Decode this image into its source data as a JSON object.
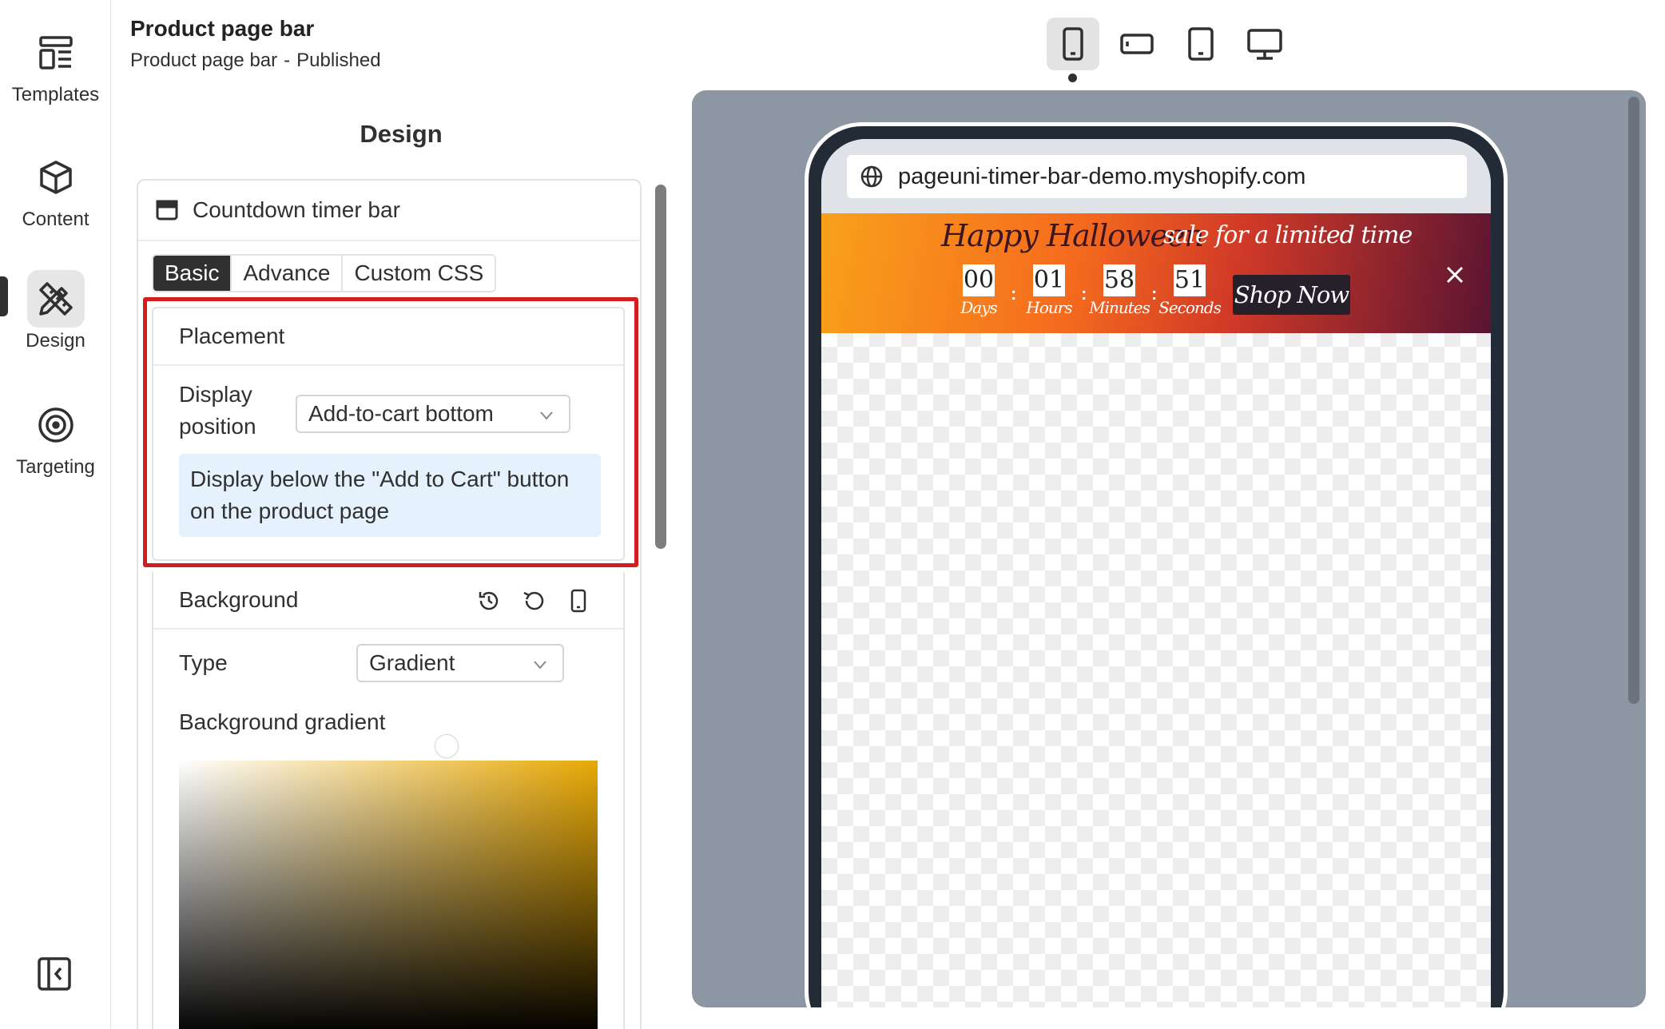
{
  "sidebar": {
    "items": [
      {
        "label": "Templates",
        "icon": "templates-icon"
      },
      {
        "label": "Content",
        "icon": "cube-icon"
      },
      {
        "label": "Design",
        "icon": "design-tools-icon",
        "active": true
      },
      {
        "label": "Targeting",
        "icon": "target-icon"
      }
    ],
    "collapse_icon": "sidebar-collapse-icon"
  },
  "header": {
    "title": "Product page bar",
    "subtitle_name": "Product page bar",
    "subtitle_sep": "-",
    "status": "Published"
  },
  "panel": {
    "heading": "Design",
    "card_title": "Countdown timer bar",
    "tabs": [
      {
        "label": "Basic",
        "active": true
      },
      {
        "label": "Advance"
      },
      {
        "label": "Custom CSS"
      }
    ],
    "placement": {
      "title": "Placement",
      "display_position_label": "Display position",
      "display_position_value": "Add-to-cart bottom",
      "info": "Display below the \"Add to Cart\" button on the product page"
    },
    "background": {
      "title": "Background",
      "type_label": "Type",
      "type_value": "Gradient",
      "gradient_label": "Background gradient",
      "gradient_color": "#e8a906"
    }
  },
  "devices": [
    {
      "name": "mobile",
      "icon": "mobile-icon",
      "active": true
    },
    {
      "name": "mobile-landscape",
      "icon": "mobile-landscape-icon"
    },
    {
      "name": "tablet",
      "icon": "tablet-icon"
    },
    {
      "name": "desktop",
      "icon": "desktop-icon"
    }
  ],
  "preview": {
    "url": "pageuni-timer-bar-demo.myshopify.com",
    "bar": {
      "headline": "Happy Halloween",
      "subheadline": "sale for a limited time",
      "countdown": [
        {
          "value": "00",
          "label": "Days"
        },
        {
          "value": "01",
          "label": "Hours"
        },
        {
          "value": "58",
          "label": "Minutes"
        },
        {
          "value": "51",
          "label": "Seconds"
        }
      ],
      "separator": ":",
      "button": "Shop Now"
    }
  },
  "colors": {
    "highlight": "#d61d1d",
    "preview_bg": "#8d96a3",
    "info_bg": "#e5f1fc"
  }
}
